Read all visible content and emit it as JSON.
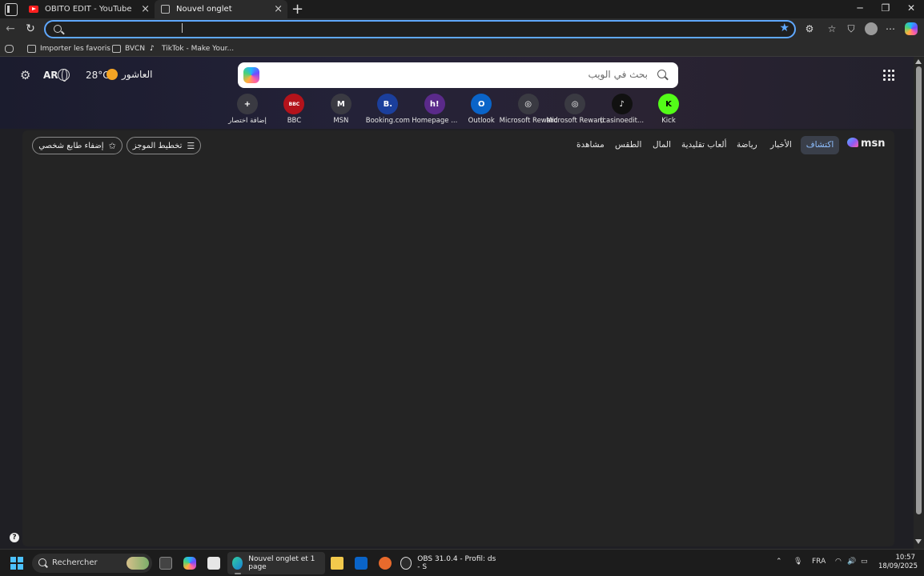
{
  "browser": {
    "tabs": [
      {
        "label": "OBITO EDIT - YouTube",
        "active": false,
        "icon": "youtube-icon"
      },
      {
        "label": "Nouvel onglet",
        "active": true,
        "icon": "page-icon"
      }
    ],
    "address_value": "",
    "bookmarks": [
      {
        "label": "Importer les favoris",
        "icon": "folder-icon"
      },
      {
        "label": "BVCN",
        "icon": "folder-icon"
      },
      {
        "label": "TikTok - Make Your...",
        "icon": "tiktok-icon"
      }
    ]
  },
  "newtab": {
    "lang": "AR",
    "temperature": "28°C",
    "city": "العاشور",
    "search_placeholder": "بحث في الويب",
    "shortcuts": [
      {
        "label": "إضافة اختصار",
        "glyph": "+",
        "color": "#3a3a42"
      },
      {
        "label": "BBC",
        "glyph": "BBC",
        "color": "#b3131b"
      },
      {
        "label": "MSN",
        "glyph": "M",
        "color": "#3a3a42"
      },
      {
        "label": "Booking.com",
        "glyph": "B.",
        "color": "#1b3f9c"
      },
      {
        "label": "Homepage ...",
        "glyph": "h!",
        "color": "#5a2a8a"
      },
      {
        "label": "Outlook",
        "glyph": "O",
        "color": "#0a64c8"
      },
      {
        "label": "Microsoft Rewards...",
        "glyph": "◎",
        "color": "#3a3a42"
      },
      {
        "label": "Microsoft Rewards...",
        "glyph": "◎",
        "color": "#3a3a42"
      },
      {
        "label": "(casinoedit...",
        "glyph": "♪",
        "color": "#111111"
      },
      {
        "label": "Kick",
        "glyph": "K",
        "color": "#53fc18"
      }
    ],
    "personalize_label": "إضفاء طابع شخصي",
    "layout_label": "تخطيط الموجز",
    "nav": [
      "اكتشاف",
      "الأخبار",
      "رياضة",
      "ألعاب تقليدية",
      "المال",
      "الطقس",
      "مشاهدة"
    ],
    "msn_logo": "msn"
  },
  "taskbar": {
    "search_label": "Rechercher",
    "edge_label": "Nouvel onglet et 1 page",
    "obs_label": "OBS 31.0.4 - Profil: ds - S",
    "lang": "FRA",
    "time": "10:57",
    "date": "18/09/2025"
  }
}
